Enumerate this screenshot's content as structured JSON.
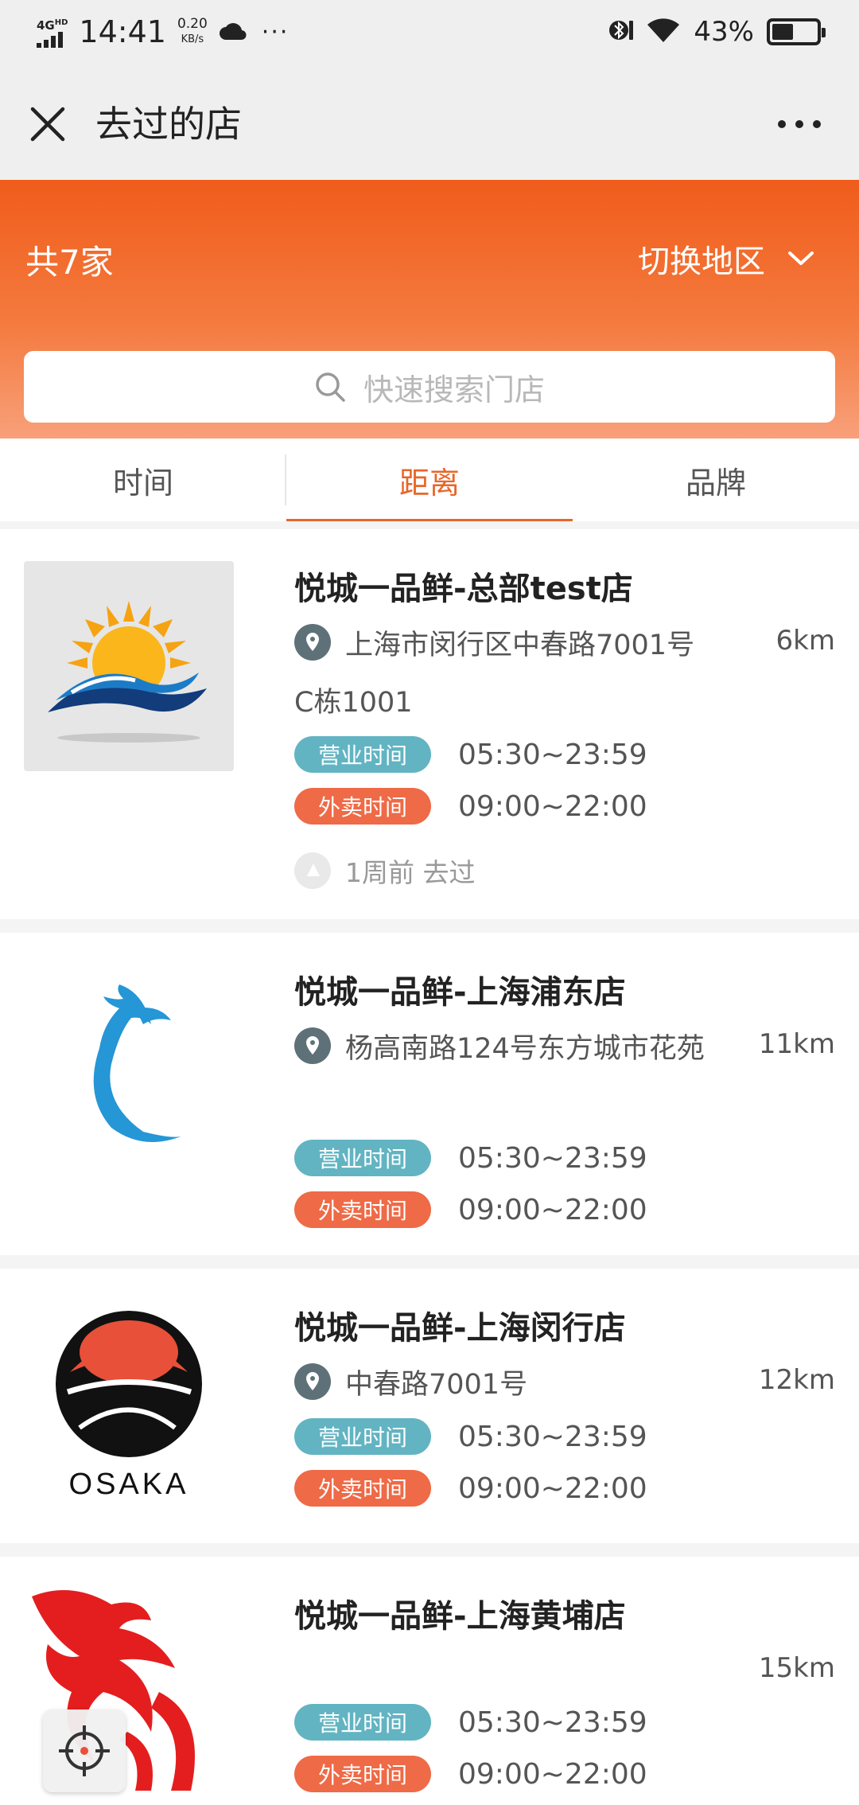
{
  "status_bar": {
    "network": "4G",
    "network_sup": "HD",
    "time": "14:41",
    "speed_value": "0.20",
    "speed_unit": "KB/s",
    "more": "···",
    "battery": "43%",
    "battery_level": 0.43
  },
  "header": {
    "title": "去过的店"
  },
  "summary": {
    "count": "共7家",
    "region_switch": "切换地区"
  },
  "search": {
    "placeholder": "快速搜索门店"
  },
  "tabs": [
    {
      "label": "时间",
      "active": false
    },
    {
      "label": "距离",
      "active": true
    },
    {
      "label": "品牌",
      "active": false
    }
  ],
  "stores": [
    {
      "name": "悦城一品鲜-总部test店",
      "address": "上海市闵行区中春路7001号C栋1001",
      "distance": "6km",
      "business_label": "营业时间",
      "business_hours": "05:30~23:59",
      "delivery_label": "外卖时间",
      "delivery_hours": "09:00~22:00",
      "visited": "1周前 去过",
      "logo": "sun-waves-logo"
    },
    {
      "name": "悦城一品鲜-上海浦东店",
      "address": "杨高南路124号东方城市花苑",
      "distance": "11km",
      "business_label": "营业时间",
      "business_hours": "05:30~23:59",
      "delivery_label": "外卖时间",
      "delivery_hours": "09:00~22:00",
      "logo": "blue-phoenix-logo"
    },
    {
      "name": "悦城一品鲜-上海闵行店",
      "address": "中春路7001号",
      "distance": "12km",
      "business_label": "营业时间",
      "business_hours": "05:30~23:59",
      "delivery_label": "外卖时间",
      "delivery_hours": "09:00~22:00",
      "logo": "osaka-logo",
      "logo_text": "OSAKA"
    },
    {
      "name": "悦城一品鲜-上海黄埔店",
      "distance": "15km",
      "business_label": "营业时间",
      "business_hours": "05:30~23:59",
      "delivery_label": "外卖时间",
      "delivery_hours": "09:00~22:00",
      "logo": "red-dragon-logo"
    }
  ],
  "colors": {
    "accent": "#e8662a",
    "header_gradient_top": "#f05c1b",
    "business_badge": "#62b4c2",
    "delivery_badge": "#ef6a46"
  }
}
